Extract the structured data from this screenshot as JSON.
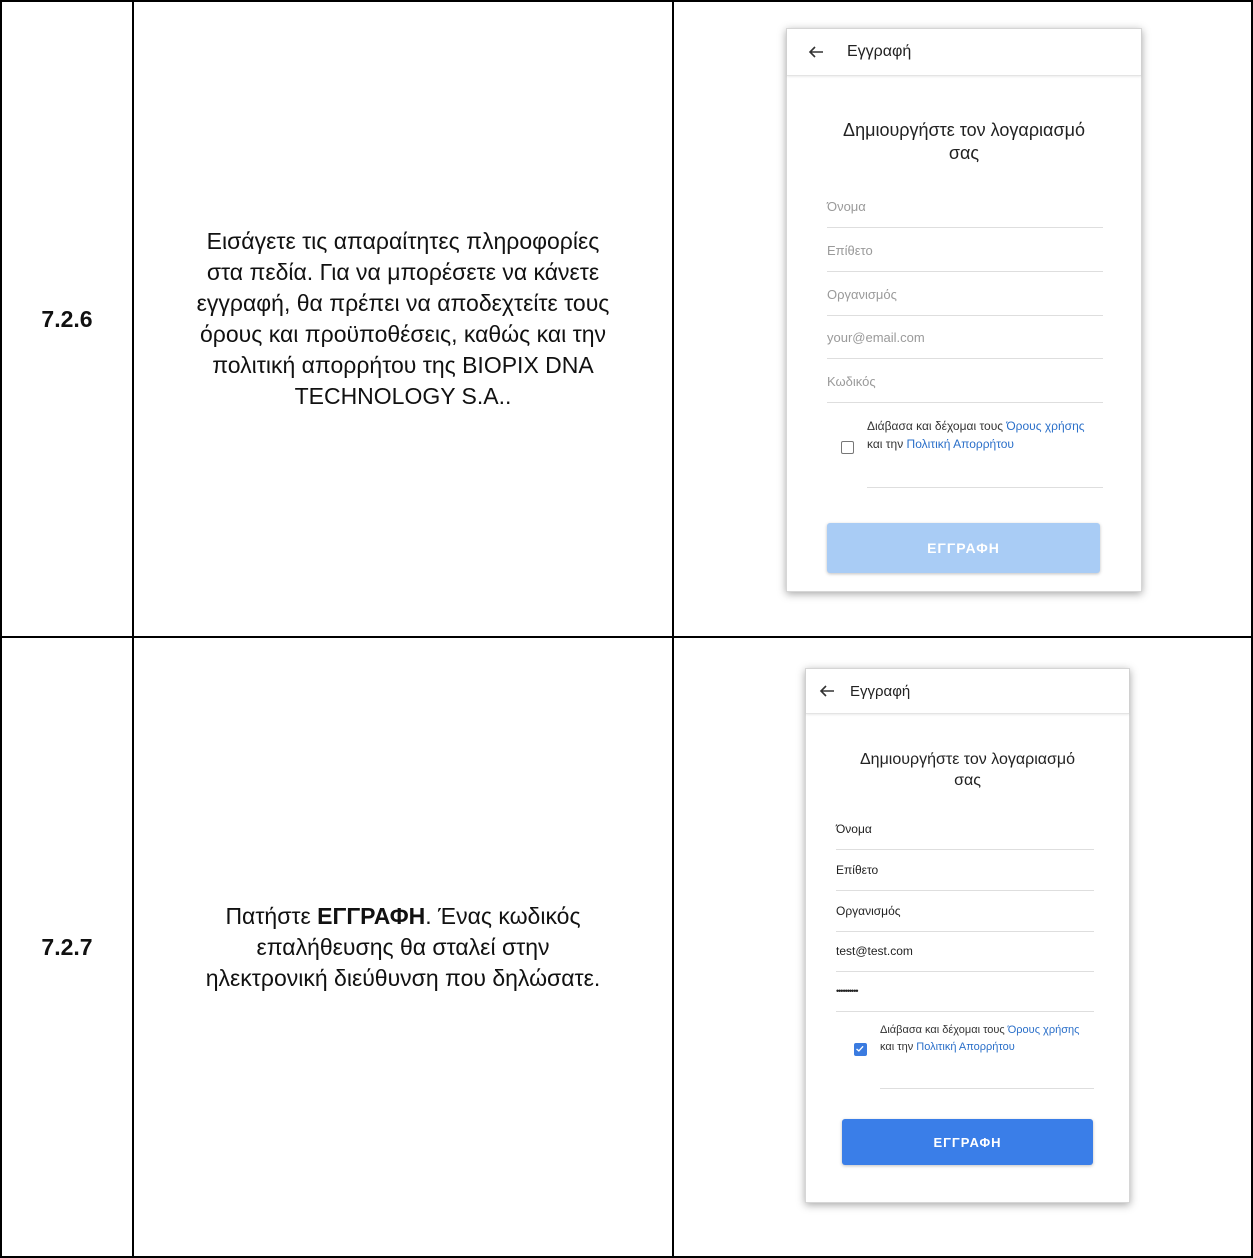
{
  "steps": [
    {
      "number": "7.2.6",
      "description_lines": [
        "Εισάγετε τις απαραίτητες πληροφορίες",
        "στα πεδία. Για να μπορέσετε να κάνετε",
        "εγγραφή, θα πρέπει να αποδεχτείτε τους",
        "όρους και προϋποθέσεις, καθώς και την",
        "πολιτική απορρήτου της BIOPIX DNA",
        "TECHNOLOGY S.A.."
      ],
      "screen": {
        "title": "Εγγραφή",
        "heading_line1": "Δημιουργήστε τον λογαριασμό",
        "heading_line2": "σας",
        "fields": [
          {
            "placeholder": "Όνομα",
            "value": ""
          },
          {
            "placeholder": "Επίθετο",
            "value": ""
          },
          {
            "placeholder": "Οργανισμός",
            "value": ""
          },
          {
            "placeholder": "your@email.com",
            "value": ""
          },
          {
            "placeholder": "Κωδικός",
            "value": ""
          }
        ],
        "terms_prefix": "Διάβασα και δέχομαι τους ",
        "terms_link1": "Όρους χρήσης",
        "terms_mid": " και την ",
        "terms_link2": "Πολιτική Απορρήτου",
        "checked": false,
        "button_label": "ΕΓΓΡΑΦΗ",
        "button_enabled": false
      }
    },
    {
      "number": "7.2.7",
      "description_pre": "Πατήστε ",
      "description_bold": "ΕΓΓΡΑΦΗ",
      "description_post": ". Ένας κωδικός",
      "description_lines": [
        "επαλήθευσης θα σταλεί στην",
        "ηλεκτρονική διεύθυνση που δηλώσατε."
      ],
      "screen": {
        "title": "Εγγραφή",
        "heading_line1": "Δημιουργήστε τον λογαριασμό",
        "heading_line2": "σας",
        "fields": [
          {
            "placeholder": "Όνομα",
            "value": "Όνομα"
          },
          {
            "placeholder": "Επίθετο",
            "value": "Επίθετο"
          },
          {
            "placeholder": "Οργανισμός",
            "value": "Οργανισμός"
          },
          {
            "placeholder": "your@email.com",
            "value": "test@test.com"
          },
          {
            "placeholder": "Κωδικός",
            "value": "••••••••••"
          }
        ],
        "terms_prefix": "Διάβασα και δέχομαι τους ",
        "terms_link1": "Όρους χρήσης",
        "terms_mid": " και την ",
        "terms_link2": "Πολιτική Απορρήτου",
        "checked": true,
        "button_label": "ΕΓΓΡΑΦΗ",
        "button_enabled": true
      }
    }
  ],
  "colors": {
    "link": "#2a6fc9",
    "button_disabled": "#a9ccf5",
    "button_enabled": "#3a7ee8",
    "checkbox_checked": "#3a7be0"
  }
}
